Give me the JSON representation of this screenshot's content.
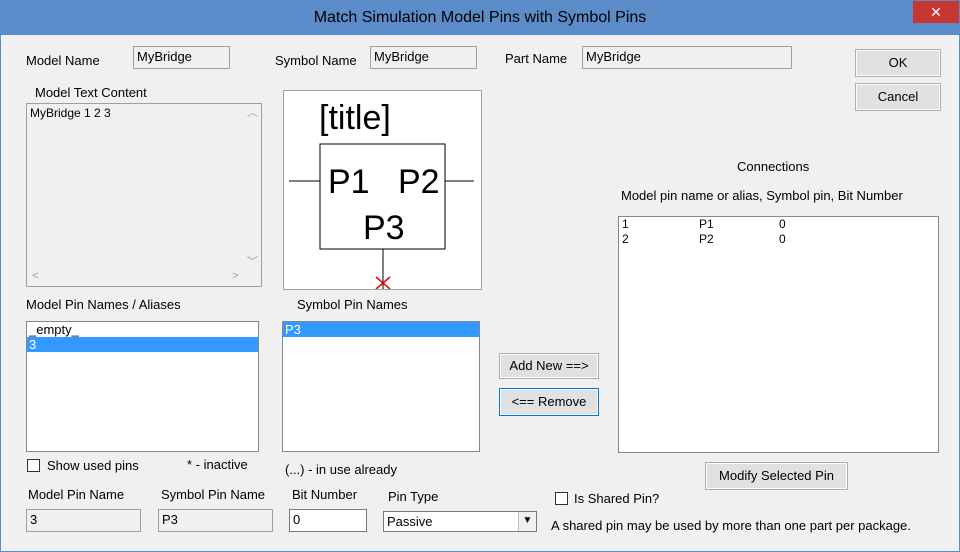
{
  "window": {
    "title": "Match Simulation Model Pins with Symbol Pins",
    "close": "✕"
  },
  "header": {
    "model_name_label": "Model Name",
    "model_name_value": "MyBridge",
    "symbol_name_label": "Symbol Name",
    "symbol_name_value": "MyBridge",
    "part_name_label": "Part Name",
    "part_name_value": "MyBridge"
  },
  "buttons": {
    "ok": "OK",
    "cancel": "Cancel",
    "add_new": "Add New ==>",
    "remove": "<== Remove",
    "modify": "Modify Selected Pin"
  },
  "model_text": {
    "label": "Model Text Content",
    "content": "MyBridge 1 2 3"
  },
  "symbol_preview": {
    "title": "[title]",
    "pin1": "P1",
    "pin2": "P2",
    "pin3": "P3"
  },
  "model_pins": {
    "label": "Model Pin Names / Aliases",
    "items": [
      "_empty_",
      "3"
    ],
    "selected": 1
  },
  "symbol_pins": {
    "label": "Symbol Pin Names",
    "items": [
      "P3"
    ],
    "selected": 0
  },
  "connections": {
    "label": "Connections",
    "sublabel": "Model pin name or alias, Symbol pin, Bit Number",
    "rows": [
      {
        "model": "1",
        "symbol": "P1",
        "bit": "0"
      },
      {
        "model": "2",
        "symbol": "P2",
        "bit": "0"
      }
    ]
  },
  "options": {
    "show_used_pins": "Show used pins",
    "inactive_note": "* - inactive",
    "in_use_note": "(...) - in use already",
    "is_shared": "Is Shared Pin?",
    "shared_note": "A shared pin may be used by more than one part per package."
  },
  "bottom": {
    "model_pin_name_label": "Model Pin Name",
    "model_pin_name_value": "3",
    "symbol_pin_name_label": "Symbol Pin Name",
    "symbol_pin_name_value": "P3",
    "bit_number_label": "Bit Number",
    "bit_number_value": "0",
    "pin_type_label": "Pin Type",
    "pin_type_value": "Passive"
  }
}
